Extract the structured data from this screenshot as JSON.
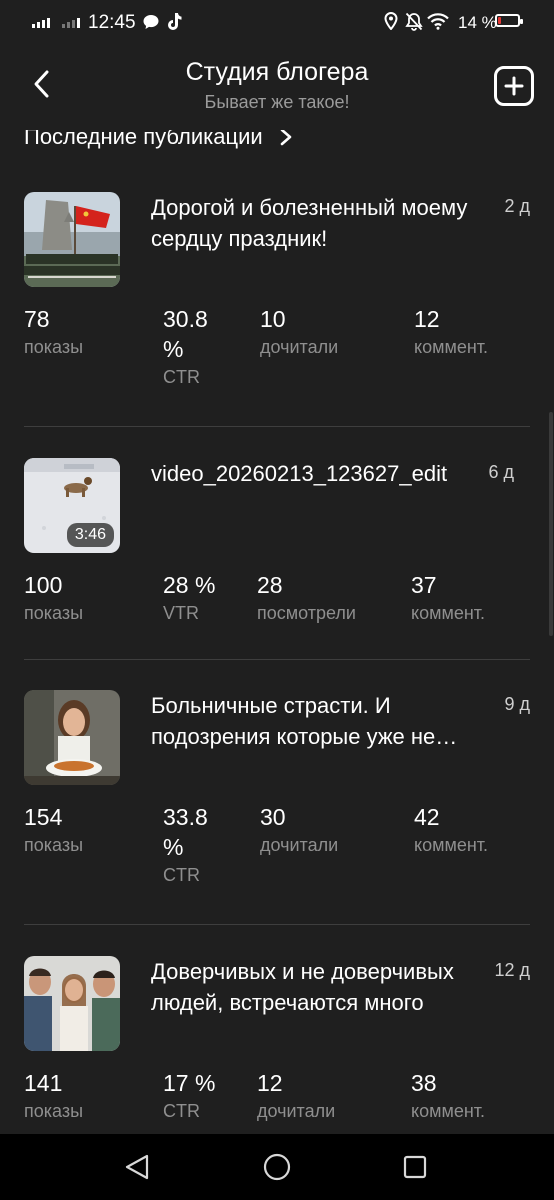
{
  "status_bar": {
    "time": "12:45",
    "battery_percent_label": "14 %",
    "battery_level": 0.14,
    "icons": [
      "signal-icon",
      "signal-icon",
      "chat-icon",
      "tiktok-icon",
      "location-icon",
      "bell-off-icon",
      "wifi-icon",
      "battery-icon"
    ]
  },
  "header": {
    "title": "Студия блогера",
    "subtitle": "Бывает же такое!",
    "back_icon": "back-arrow-icon",
    "add_icon": "add-square-icon"
  },
  "section": {
    "title": "Последние публикации",
    "chevron_icon": "chevron-right-icon"
  },
  "posts": [
    {
      "title": "Дорогой и болезненный моему сердцу праздник!",
      "age": "2 д",
      "stats": [
        {
          "value": "78",
          "label": "показы"
        },
        {
          "value": "30.8 %",
          "label": "CTR"
        },
        {
          "value": "10",
          "label": "дочитали"
        },
        {
          "value": "12",
          "label": "коммент."
        }
      ]
    },
    {
      "title": "video_20260213_123627_edit",
      "age": "6 д",
      "duration": "3:46",
      "stats": [
        {
          "value": "100",
          "label": "показы"
        },
        {
          "value": "28 %",
          "label": "VTR"
        },
        {
          "value": "28",
          "label": "посмотрели"
        },
        {
          "value": "37",
          "label": "коммент."
        }
      ]
    },
    {
      "title": "Больничные страсти. И подозрения которые уже не вызывают сомнений",
      "age": "9 д",
      "stats": [
        {
          "value": "154",
          "label": "показы"
        },
        {
          "value": "33.8 %",
          "label": "CTR"
        },
        {
          "value": "30",
          "label": "дочитали"
        },
        {
          "value": "42",
          "label": "коммент."
        }
      ]
    },
    {
      "title": "Доверчивых и не доверчивых людей, встречаются много",
      "age": "12 д",
      "stats": [
        {
          "value": "141",
          "label": "показы"
        },
        {
          "value": "17 %",
          "label": "CTR"
        },
        {
          "value": "12",
          "label": "дочитали"
        },
        {
          "value": "38",
          "label": "коммент."
        }
      ]
    }
  ],
  "nav_bar": {
    "back_icon": "triangle-back-icon",
    "home_icon": "circle-home-icon",
    "recents_icon": "square-recents-icon"
  }
}
